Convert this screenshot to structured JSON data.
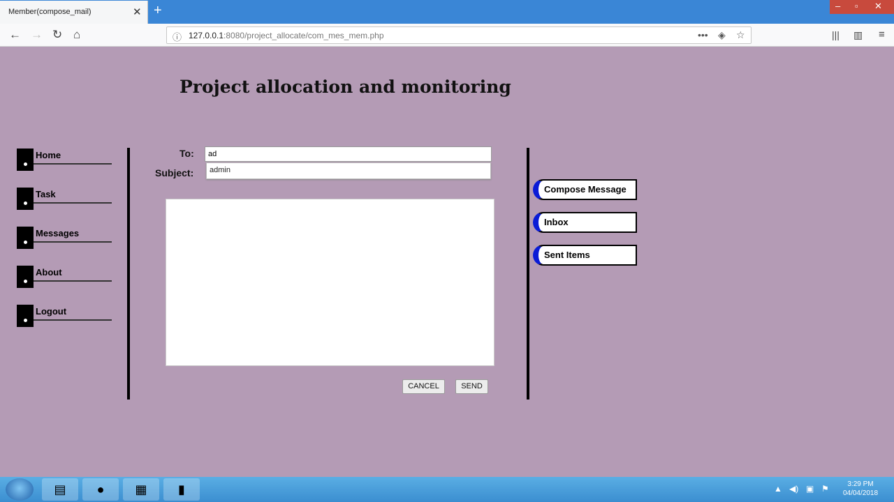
{
  "browser": {
    "tab_title": "Member(compose_mail)",
    "tab_close": "✕",
    "new_tab": "+",
    "url_host": "127.0.0.1",
    "url_path": ":8080/project_allocate/com_mes_mem.php"
  },
  "page": {
    "title": "Project allocation and monitoring"
  },
  "sidebar": {
    "items": [
      {
        "label": "Home"
      },
      {
        "label": "Task"
      },
      {
        "label": "Messages"
      },
      {
        "label": "About"
      },
      {
        "label": "Logout"
      }
    ]
  },
  "compose": {
    "to_label": "To:",
    "to_value": "ad",
    "subject_label": "Subject:",
    "autocomplete_option": "admin",
    "cancel_label": "CANCEL",
    "send_label": "SEND"
  },
  "mail_nav": {
    "items": [
      {
        "label": "Compose Message"
      },
      {
        "label": "Inbox"
      },
      {
        "label": "Sent Items"
      }
    ]
  },
  "taskbar": {
    "time": "3:29 PM",
    "date": "04/04/2018"
  },
  "colors": {
    "page_bg": "#b49bb5",
    "accent_blue": "#0a1bd6",
    "tabbar": "#3a86d6"
  }
}
